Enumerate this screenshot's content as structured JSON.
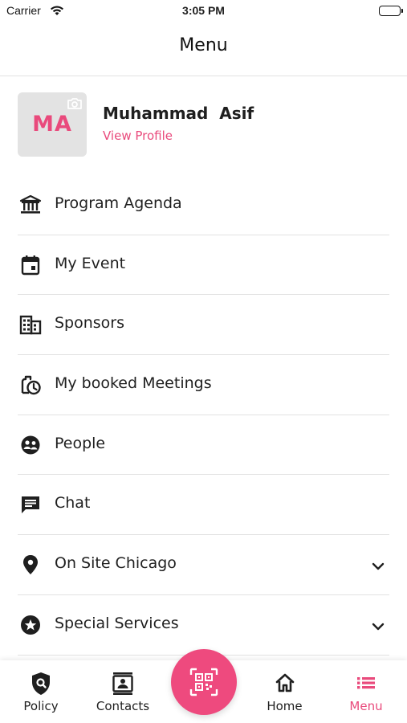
{
  "status_bar": {
    "carrier": "Carrier",
    "time": "3:05 PM"
  },
  "header": {
    "title": "Menu"
  },
  "profile": {
    "initials": "MA",
    "name": "Muhammad  Asif",
    "link": "View Profile"
  },
  "menu": {
    "items": [
      {
        "label": "Program Agenda",
        "icon": "bank-icon"
      },
      {
        "label": "My Event",
        "icon": "calendar-icon"
      },
      {
        "label": "Sponsors",
        "icon": "building-icon"
      },
      {
        "label": "My booked Meetings",
        "icon": "meeting-clock-icon"
      },
      {
        "label": "People",
        "icon": "people-icon"
      },
      {
        "label": "Chat",
        "icon": "chat-icon"
      },
      {
        "label": "On Site Chicago",
        "icon": "location-pin-icon",
        "expandable": true
      },
      {
        "label": "Special Services",
        "icon": "star-icon",
        "expandable": true
      }
    ]
  },
  "tabbar": {
    "tabs": [
      {
        "label": "Policy",
        "icon": "shield-icon"
      },
      {
        "label": "Contacts",
        "icon": "contacts-icon"
      },
      {
        "label": "Home",
        "icon": "home-icon"
      },
      {
        "label": "Menu",
        "icon": "list-icon",
        "active": true
      }
    ],
    "center_button_icon": "qr-scan-icon"
  },
  "colors": {
    "accent": "#e94a7c",
    "text": "#1f1f1f",
    "divider": "#e2e2e2",
    "avatar_bg": "#e3e3e3"
  }
}
